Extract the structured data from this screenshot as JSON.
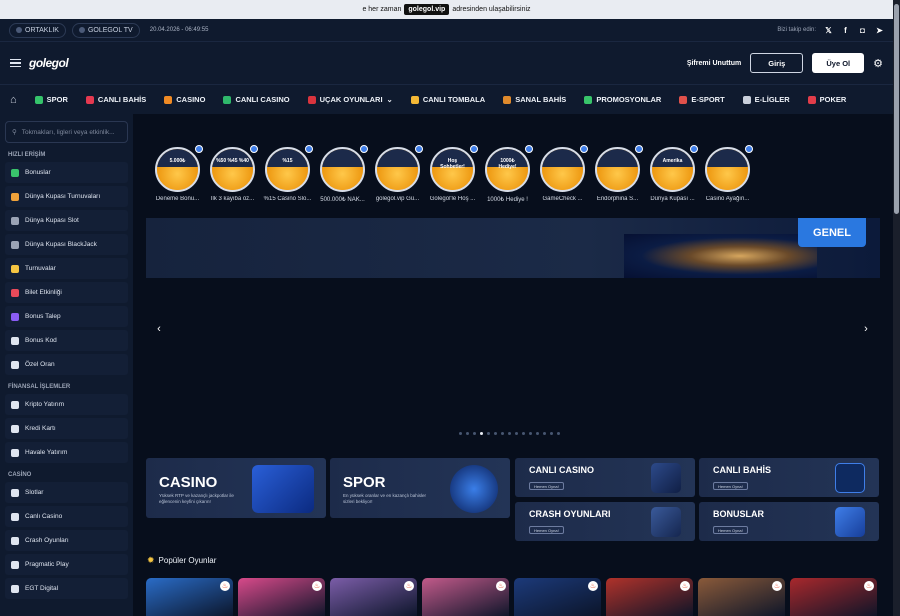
{
  "topbar": {
    "prefix": "e her zaman",
    "domain": "golegol.vip",
    "suffix": "adresinden ulaşabilirsiniz"
  },
  "infobar": {
    "partner_label": "ORTAKLIK",
    "tv_label": "GOLEGOL TV",
    "datetime": "20.04.2026 - 06:49:55",
    "follow_label": "Bizi takip edin:"
  },
  "header": {
    "logo": "golegol",
    "forgot_label": "Şifremi Unuttum",
    "login_label": "Giriş",
    "register_label": "Üye Ol"
  },
  "nav": {
    "items": [
      {
        "label": "SPOR",
        "color": "#35c46b"
      },
      {
        "label": "CANLI BAHİS",
        "color": "#e53950"
      },
      {
        "label": "CASINO",
        "color": "#f08a24"
      },
      {
        "label": "CANLI CASINO",
        "color": "#2fb86b"
      },
      {
        "label": "UÇAK OYUNLARI",
        "color": "#d9343e"
      },
      {
        "label": "CANLI TOMBALA",
        "color": "#f5b936"
      },
      {
        "label": "SANAL BAHİS",
        "color": "#e08a2c"
      },
      {
        "label": "PROMOSYONLAR",
        "color": "#38c46a"
      },
      {
        "label": "E-SPORT",
        "color": "#e0514b"
      },
      {
        "label": "E-LİGLER",
        "color": "#c9cfdb"
      },
      {
        "label": "POKER",
        "color": "#e23d4a"
      }
    ]
  },
  "sidebar": {
    "search_placeholder": "Tokmakları, ligleri veya etkinlik...",
    "quick_access_title": "HIZLI ERİŞİM",
    "quick_access": [
      {
        "label": "Bonuslar",
        "color": "#39c46b"
      },
      {
        "label": "Dünya Kupası Turnuvaları",
        "color": "#f0a23a"
      },
      {
        "label": "Dünya Kupası Slot",
        "color": "#9aa3b5"
      },
      {
        "label": "Dünya Kupası BlackJack",
        "color": "#9aa3b5"
      },
      {
        "label": "Turnuvalar",
        "color": "#f5c542"
      },
      {
        "label": "Bilet Etkinliği",
        "color": "#e84a5a"
      },
      {
        "label": "Bonus Talep",
        "color": "#8a5cf5"
      },
      {
        "label": "Bonus Kod",
        "color": "#dfe5f0"
      },
      {
        "label": "Özel Oran",
        "color": "#dfe5f0"
      }
    ],
    "finance_title": "FİNANSAL İŞLEMLER",
    "finance": [
      {
        "label": "Kripto Yatırım",
        "color": "#dfe5f0"
      },
      {
        "label": "Kredi Kartı",
        "color": "#dfe5f0"
      },
      {
        "label": "Havale Yatırım",
        "color": "#dfe5f0"
      }
    ],
    "casino_title": "CASİNO",
    "casino": [
      {
        "label": "Slotlar",
        "color": "#dfe5f0"
      },
      {
        "label": "Canlı Casino",
        "color": "#dfe5f0"
      },
      {
        "label": "Crash Oyunları",
        "color": "#dfe5f0"
      },
      {
        "label": "Pragmatic Play",
        "color": "#dfe5f0"
      },
      {
        "label": "EGT Digital",
        "color": "#dfe5f0"
      }
    ]
  },
  "stories": [
    {
      "text": "5.000₺",
      "label": "Deneme Bonu..."
    },
    {
      "text": "%50 %45 %40",
      "label": "İlk 3 kayıba öz..."
    },
    {
      "text": "%15",
      "label": "%15 Casino Slo..."
    },
    {
      "text": "",
      "label": "500.000₺ NAK..."
    },
    {
      "text": "",
      "label": "golegol.vip Gü..."
    },
    {
      "text": "Hoş Sohbetler!",
      "label": "Golegol'le Hoş ..."
    },
    {
      "text": "1000₺ Hediye!",
      "label": "1000₺ Hediye !"
    },
    {
      "text": "",
      "label": "GameCheck ..."
    },
    {
      "text": "",
      "label": "Endorphina S..."
    },
    {
      "text": "Amerika",
      "label": "Dünya Kupası ..."
    },
    {
      "text": "",
      "label": "Casino Ayağın..."
    }
  ],
  "banner": {
    "tag": "GENEL"
  },
  "carousel": {
    "active_index": 3,
    "count": 15
  },
  "categories": {
    "casino": {
      "title": "CASINO",
      "desc": "Yüksek RTP ve kazançlı jackpotlar ile eğlencenin keyfini çıkarın!"
    },
    "spor": {
      "title": "SPOR",
      "desc": "En yüksek oranlar ve en kazançlı bahisler sizleri bekliyor!"
    },
    "canli_casino": {
      "title": "CANLI CASINO",
      "button": "Hemen Oyna!"
    },
    "canli_bahis": {
      "title": "CANLI BAHİS",
      "button": "Hemen Oyna!"
    },
    "crash": {
      "title": "CRASH OYUNLARI",
      "button": "Hemen Oyna!"
    },
    "bonuslar": {
      "title": "BONUSLAR",
      "button": "Hemen Oyna!"
    }
  },
  "popular": {
    "title": "Popüler Oyunlar",
    "games": [
      "#2a6cc7",
      "#d84a8a",
      "#7b5da8",
      "#c25a8a",
      "#1c3a7a",
      "#b0322a",
      "#8a5a3a",
      "#a8282c"
    ]
  }
}
